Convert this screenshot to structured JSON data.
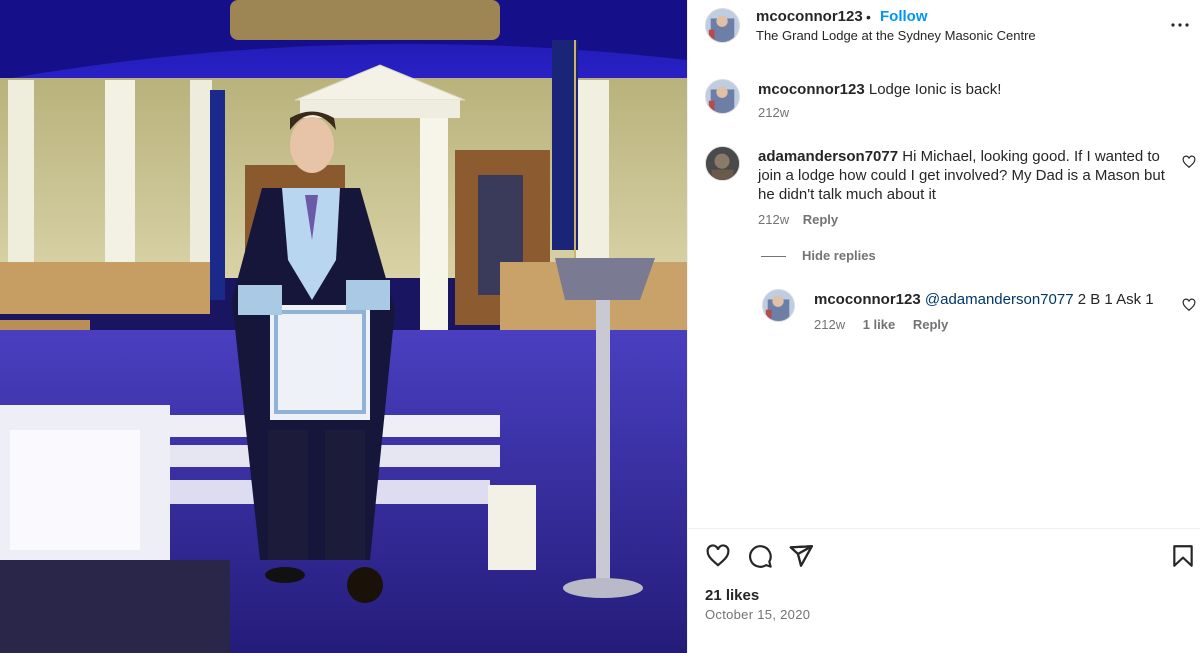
{
  "post": {
    "image_alt": "Man in Masonic regalia standing in the Grand Lodge hall"
  },
  "header": {
    "username": "mcoconnor123",
    "dot": "•",
    "follow_label": "Follow",
    "location": "The Grand Lodge at the Sydney Masonic Centre"
  },
  "caption": {
    "username": "mcoconnor123",
    "text": "Lodge Ionic is back!",
    "time": "212w"
  },
  "comment": {
    "username": "adamanderson7077",
    "text": "Hi Michael, looking good. If I wanted to join a lodge how could I get involved? My Dad is a Mason but he didn't talk much about it",
    "time": "212w",
    "reply_label": "Reply"
  },
  "hide_replies_label": "Hide replies",
  "reply": {
    "username": "mcoconnor123",
    "mention": "@adamanderson7077",
    "text": "2 B 1 Ask 1",
    "time": "212w",
    "likes": "1 like",
    "reply_label": "Reply"
  },
  "footer": {
    "likes": "21 likes",
    "date": "October 15, 2020"
  },
  "icons": {
    "like": "heart-icon",
    "comment": "comment-icon",
    "share": "share-icon",
    "save": "bookmark-icon",
    "more": "more-options-icon"
  }
}
